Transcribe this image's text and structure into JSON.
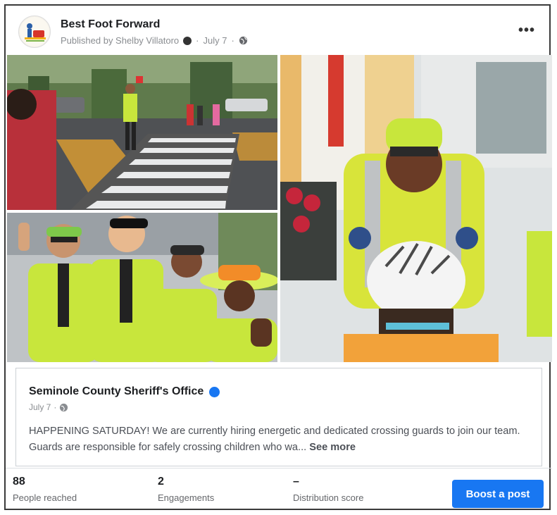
{
  "post": {
    "page_name": "Best Foot Forward",
    "published_by": "Published by Shelby Villatoro",
    "date": "July 7",
    "more_icon": "more-horizontal-icon",
    "privacy_icon": "globe-icon"
  },
  "photos": [
    {
      "label": "",
      "icon": "photo-crosswalk"
    },
    {
      "label": "",
      "icon": "photo-crossing-guards-group"
    },
    {
      "label": "",
      "icon": "photo-guard-with-child"
    }
  ],
  "link_card": {
    "org_name": "Seminole County Sheriff's Office",
    "verified_icon": "verified-badge-icon",
    "date": "July 7",
    "text": "HAPPENING SATURDAY! We are currently hiring energetic and dedicated crossing guards to join our team. Guards are responsible for safely crossing children who wa...",
    "see_more": "See more"
  },
  "stats": {
    "reached_value": "88",
    "reached_label": "People reached",
    "engagements_value": "2",
    "engagements_label": "Engagements",
    "distribution_value": "–",
    "distribution_label": "Distribution score"
  },
  "boost_button": "Boost a post",
  "colors": {
    "accent": "#1877f2",
    "vest": "#c8e63c",
    "text_muted": "#8a8d91"
  }
}
